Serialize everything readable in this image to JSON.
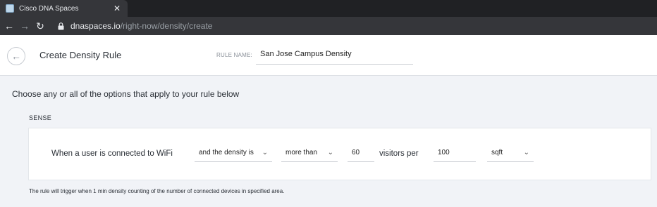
{
  "browser": {
    "tab_title": "Cisco DNA Spaces",
    "tab_close_icon": "✕",
    "url_domain": "dnaspaces.io",
    "url_path": "/right-now/density/create"
  },
  "header": {
    "back_icon": "←",
    "title": "Create Density Rule",
    "rule_name_label": "RULE NAME:",
    "rule_name_value": "San Jose Campus Density"
  },
  "main": {
    "instructions": "Choose any or all of the options that apply to your rule below",
    "section_label": "SENSE",
    "rule": {
      "sentence": "When a user is connected to WiFi",
      "condition_dropdown": "and the density is",
      "comparator_dropdown": "more than",
      "count_value": "60",
      "visitors_per_label": "visitors per",
      "area_value": "100",
      "unit_dropdown": "sqft"
    },
    "footnote": "The rule will trigger when 1 min density counting of the number of connected devices in specified area."
  },
  "colors": {
    "browser_dark": "#202124",
    "browser_tab": "#35363a",
    "content_bg": "#f1f3f7"
  }
}
